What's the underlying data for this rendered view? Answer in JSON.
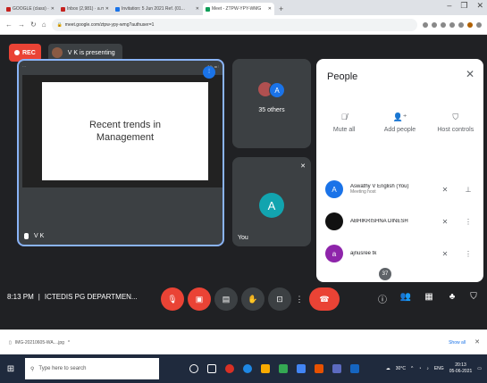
{
  "browser": {
    "tabs": [
      {
        "label": "GOOGLE (class) · GOOGLE F...",
        "fav": "gmail",
        "active": false
      },
      {
        "label": "Inbox (2,981) · a.mathew...",
        "fav": "gmail",
        "active": false
      },
      {
        "label": "Invitation: 5 Jun 2021 Ref. (01...",
        "fav": "calendar",
        "active": false
      },
      {
        "label": "Meet - ZTPW-YPY-WMG",
        "fav": "meet",
        "active": true
      }
    ],
    "new_tab": "+",
    "window_controls": [
      "–",
      "❐",
      "✕"
    ],
    "url": "meet.google.com/ztpw-ypy-wmg?authuser=1"
  },
  "meet": {
    "rec_label": "REC",
    "presenting_label": "V K is presenting",
    "main_tile": {
      "slide_title": "Recent trends in Management",
      "name": "V K"
    },
    "side_tiles": {
      "others_avatar": "A",
      "others_label": "35 others",
      "you_avatar": "A",
      "you_label": "You"
    },
    "people_panel": {
      "title": "People",
      "close": "✕",
      "actions": [
        {
          "label": "Mute all",
          "icon": "mic-off-icon"
        },
        {
          "label": "Add people",
          "icon": "person-add-icon"
        },
        {
          "label": "Host controls",
          "icon": "shield-lock-icon"
        }
      ],
      "participants": [
        {
          "initial": "A",
          "name": "Aswathy V English (You)",
          "sub": "Meeting host",
          "color": "#1a73e8"
        },
        {
          "initial": "",
          "name": "ABHIKRISHNA DINESH",
          "sub": "",
          "color": "#111111"
        },
        {
          "initial": "a",
          "name": "ajnusree tk",
          "sub": "",
          "color": "#8e24aa"
        }
      ]
    },
    "bottom_bar": {
      "time": "8:13 PM",
      "separator": "|",
      "meeting_name": "ICTEDIS PG DEPARTMEN...",
      "participant_count": "37"
    }
  },
  "downloads": {
    "file": "IMG-20210605-WA....jpg",
    "show_all": "Show all",
    "close": "✕"
  },
  "taskbar": {
    "search_placeholder": "Type here to search",
    "weather": "30°C",
    "language": "ENG",
    "time": "20:13",
    "date": "05-06-2021"
  },
  "colors": {
    "meet_bg": "#202124",
    "tile_bg": "#3c4043",
    "accent_blue": "#1a73e8",
    "record_red": "#ea4335",
    "speaker_outline": "#8ab4f8"
  }
}
